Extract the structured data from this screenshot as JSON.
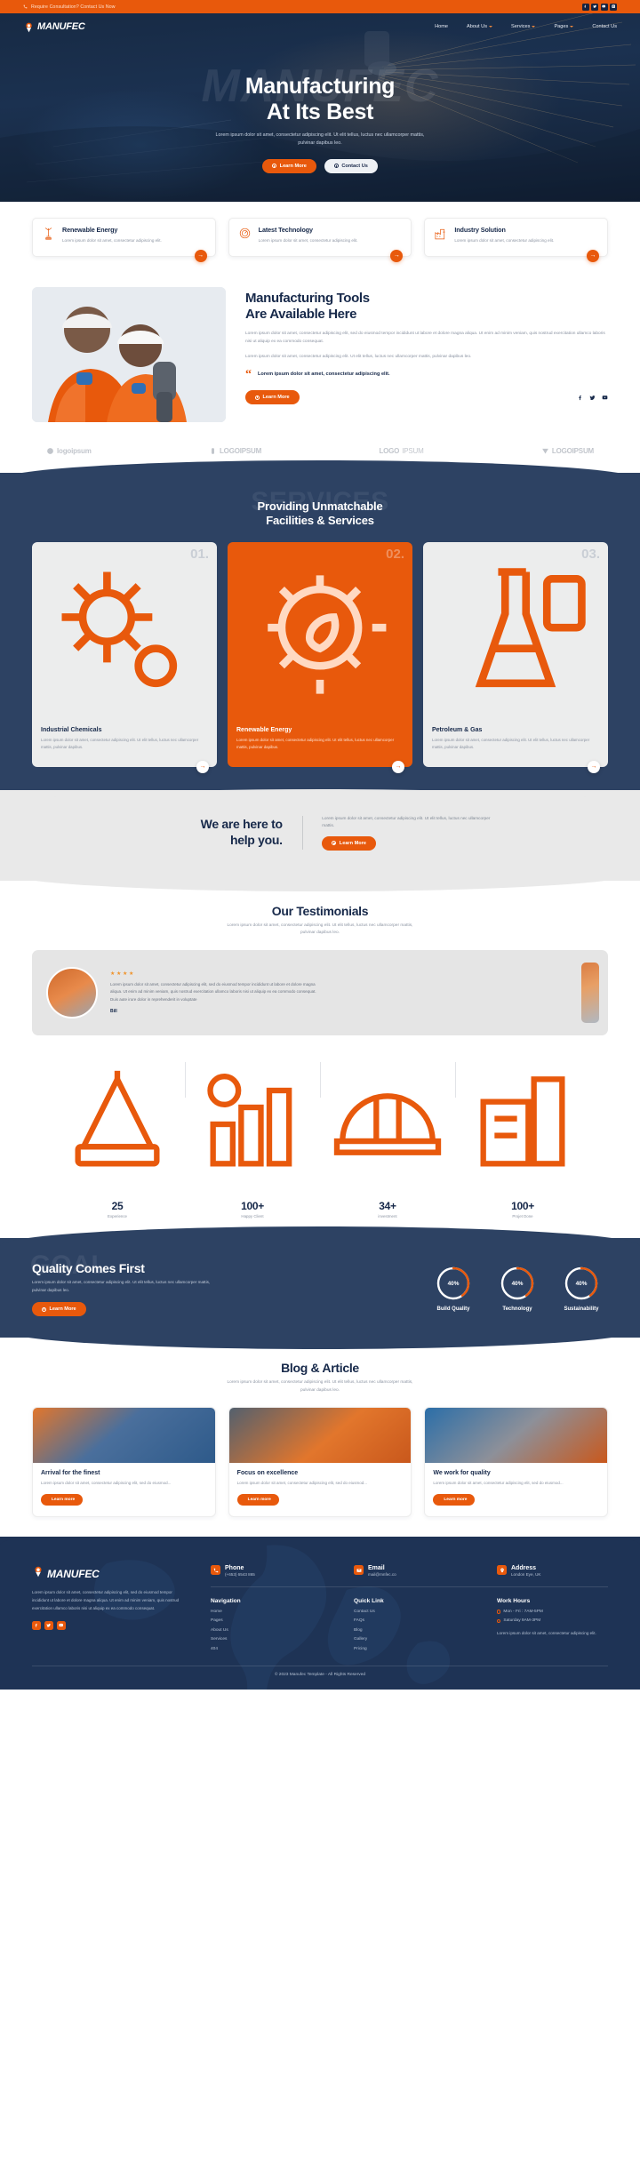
{
  "colors": {
    "orange": "#e8590c",
    "navy": "#17294a",
    "slate": "#2d4263",
    "footer": "#1e3355"
  },
  "topbar": {
    "message": "Require Consultation? Contact Us Now",
    "socials": [
      "facebook-icon",
      "twitter-icon",
      "youtube-icon",
      "instagram-icon"
    ]
  },
  "nav": {
    "brand": "MANUFEC",
    "items": [
      {
        "label": "Home",
        "has_dropdown": false
      },
      {
        "label": "About Us",
        "has_dropdown": true
      },
      {
        "label": "Services",
        "has_dropdown": true
      },
      {
        "label": "Pages",
        "has_dropdown": true
      },
      {
        "label": "Contact Us",
        "has_dropdown": false
      }
    ]
  },
  "hero": {
    "watermark": "MANUFEC",
    "title_line1": "Manufacturing",
    "title_line2": "At Its Best",
    "subtitle": "Lorem ipsum dolor sit amet, consectetur adipiscing elit. Ut elit tellus, luctus nec ullamcorper mattis, pulvinar dapibus leo.",
    "primary_button": "Learn More",
    "secondary_button": "Contact Us"
  },
  "features": [
    {
      "title": "Renewable Energy",
      "desc": "Lorem ipsum dolor sit amet, consectetur adipiscing elit.",
      "icon": "wind-turbine-icon"
    },
    {
      "title": "Latest Technology",
      "desc": "Lorem ipsum dolor sit amet, consectetur adipiscing elit.",
      "icon": "gauge-icon"
    },
    {
      "title": "Industry Solution",
      "desc": "Lorem ipsum dolor sit amet, consectetur adipiscing elit.",
      "icon": "factory-icon"
    }
  ],
  "tools": {
    "title_line1": "Manufacturing Tools",
    "title_line2": "Are Available Here",
    "paragraph1": "Lorem ipsum dolor sit amet, consectetur adipiscing elit, sed do eiusmod tempor incididunt ut labore et dolore magna aliqua. Ut enim ad minim veniam, quis nostrud exercitation ullamco laboris nisi ut aliquip ex ea commodo consequat.",
    "paragraph2": "Lorem ipsum dolor sit amet, consectetur adipiscing elit. Ut elit tellus, luctus nec ullamcorper mattis, pulvinar dapibus leo.",
    "quote": "Lorem ipsum dolor sit amet, consectetur adipiscing elit.",
    "button": "Learn More",
    "socials": [
      "facebook-icon",
      "twitter-icon",
      "youtube-icon"
    ]
  },
  "logos": [
    {
      "text": "logoipsum",
      "sub": "Logo"
    },
    {
      "text": "LOGOIPSUM",
      "sub": ""
    },
    {
      "text": "LOGO",
      "sub": "IPSUM"
    },
    {
      "text": "LOGOIPSUM",
      "sub": ""
    }
  ],
  "services": {
    "watermark": "SERVICES",
    "title_line1": "Providing Unmatchable",
    "title_line2": "Facilities & Services",
    "cards": [
      {
        "num": "01.",
        "title": "Industrial Chemicals",
        "desc": "Lorem ipsum dolor sit amet, consectetur adipiscing elit. Ut elit tellus, luctus nec ullamcorper mattis, pulvinar dapibus.",
        "icon": "gears-icon",
        "active": false
      },
      {
        "num": "02.",
        "title": "Renewable Energy",
        "desc": "Lorem ipsum dolor sit amet, consectetur adipiscing elit. Ut elit tellus, luctus nec ullamcorper mattis, pulvinar dapibus.",
        "icon": "eco-gear-icon",
        "active": true
      },
      {
        "num": "03.",
        "title": "Petroleum & Gas",
        "desc": "Lorem ipsum dolor sit amet, consectetur adipiscing elit. Ut elit tellus, luctus nec ullamcorper mattis, pulvinar dapibus.",
        "icon": "flask-icon",
        "active": false
      }
    ]
  },
  "help": {
    "title_line1": "We are here to",
    "title_line2": "help you.",
    "paragraph": "Lorem ipsum dolor sit amet, consectetur adipiscing elit. Ut elit tellus, luctus nec ullamcorper mattis.",
    "button": "Learn More"
  },
  "testimonials": {
    "title": "Our Testimonials",
    "subtitle": "Lorem ipsum dolor sit amet, consectetur adipiscing elit. Ut elit tellus, luctus nec ullamcorper mattis, pulvinar dapibus leo.",
    "stars": 4,
    "quote": "Lorem ipsum dolor sit amet, consectetur adipiscing elit, sed do eiusmod tempor incididunt ut labore et dolore magna aliqua. Ut enim ad minim veniam, quis nostrud exercitation ullamco laboris nisi ut aliquip ex ea commodo consequat. Duis aute irure dolor in reprehenderit in voluptate",
    "author": "Bill"
  },
  "stats": [
    {
      "value": "25",
      "label": "Experience",
      "icon": "crane-icon"
    },
    {
      "value": "100+",
      "label": "Happy Client",
      "icon": "chart-icon"
    },
    {
      "value": "34+",
      "label": "investment",
      "icon": "helmet-icon"
    },
    {
      "value": "100+",
      "label": "Projet Done",
      "icon": "building-icon"
    }
  ],
  "goal": {
    "watermark": "GOAL",
    "title": "Quality Comes First",
    "paragraph": "Lorem ipsum dolor sit amet, consectetur adipiscing elit. Ut elit tellus, luctus nec ullamcorper mattis, pulvinar dapibus leo.",
    "button": "Learn More",
    "rings": [
      {
        "value": "40%",
        "percent": 40,
        "label": "Build Quality"
      },
      {
        "value": "40%",
        "percent": 40,
        "label": "Technology"
      },
      {
        "value": "40%",
        "percent": 40,
        "label": "Sustainability"
      }
    ]
  },
  "blog": {
    "title": "Blog & Article",
    "subtitle": "Lorem ipsum dolor sit amet, consectetur adipiscing elit. Ut elit tellus, luctus nec ullamcorper mattis, pulvinar dapibus leo.",
    "posts": [
      {
        "title": "Arrival for the finest",
        "desc": "Lorem ipsum dolor sit amet, consectetur adipiscing elit, sed do eiusmod...",
        "button": "Learn more"
      },
      {
        "title": "Focus on excellence",
        "desc": "Lorem ipsum dolor sit amet, consectetur adipiscing elit, sed do eiusmod...",
        "button": "Learn more"
      },
      {
        "title": "We work for quality",
        "desc": "Lorem ipsum dolor sit amet, consectetur adipiscing elit, sed do eiusmod...",
        "button": "Learn more"
      }
    ]
  },
  "footer": {
    "brand": "MANUFEC",
    "about": "Lorem ipsum dolor sit amet, consectetur adipiscing elit, sed do eiusmod tempor incididunt ut labore et dolore magna aliqua. Ut enim ad minim veniam, quis nostrud exercitation ullamco laboris nisi ut aliquip ex ea commodo consequat.",
    "socials": [
      "facebook-icon",
      "twitter-icon",
      "youtube-icon"
    ],
    "contacts": [
      {
        "label": "Phone",
        "value": "(+653) 6543 865",
        "icon": "phone-icon"
      },
      {
        "label": "Email",
        "value": "mail@mnfec.co",
        "icon": "envelope-icon"
      },
      {
        "label": "Address",
        "value": "London Eye, UK",
        "icon": "map-pin-icon"
      }
    ],
    "navigation": {
      "title": "Navigation",
      "links": [
        "Home",
        "Pages",
        "About Us",
        "Services",
        "404"
      ]
    },
    "quicklink": {
      "title": "Quick Link",
      "links": [
        "Contact Us",
        "FAQs",
        "Blog",
        "Gallery",
        "Pricing"
      ]
    },
    "workhours": {
      "title": "Work Hours",
      "rows": [
        "Mon - Fri : 7AM-5PM",
        "Saturday 9AM-3PM"
      ],
      "note": "Lorem ipsum dolor sit amet, consectetur adipiscing elit."
    },
    "copyright": "© 2023 Manufec Template - All Rights Reserved"
  }
}
